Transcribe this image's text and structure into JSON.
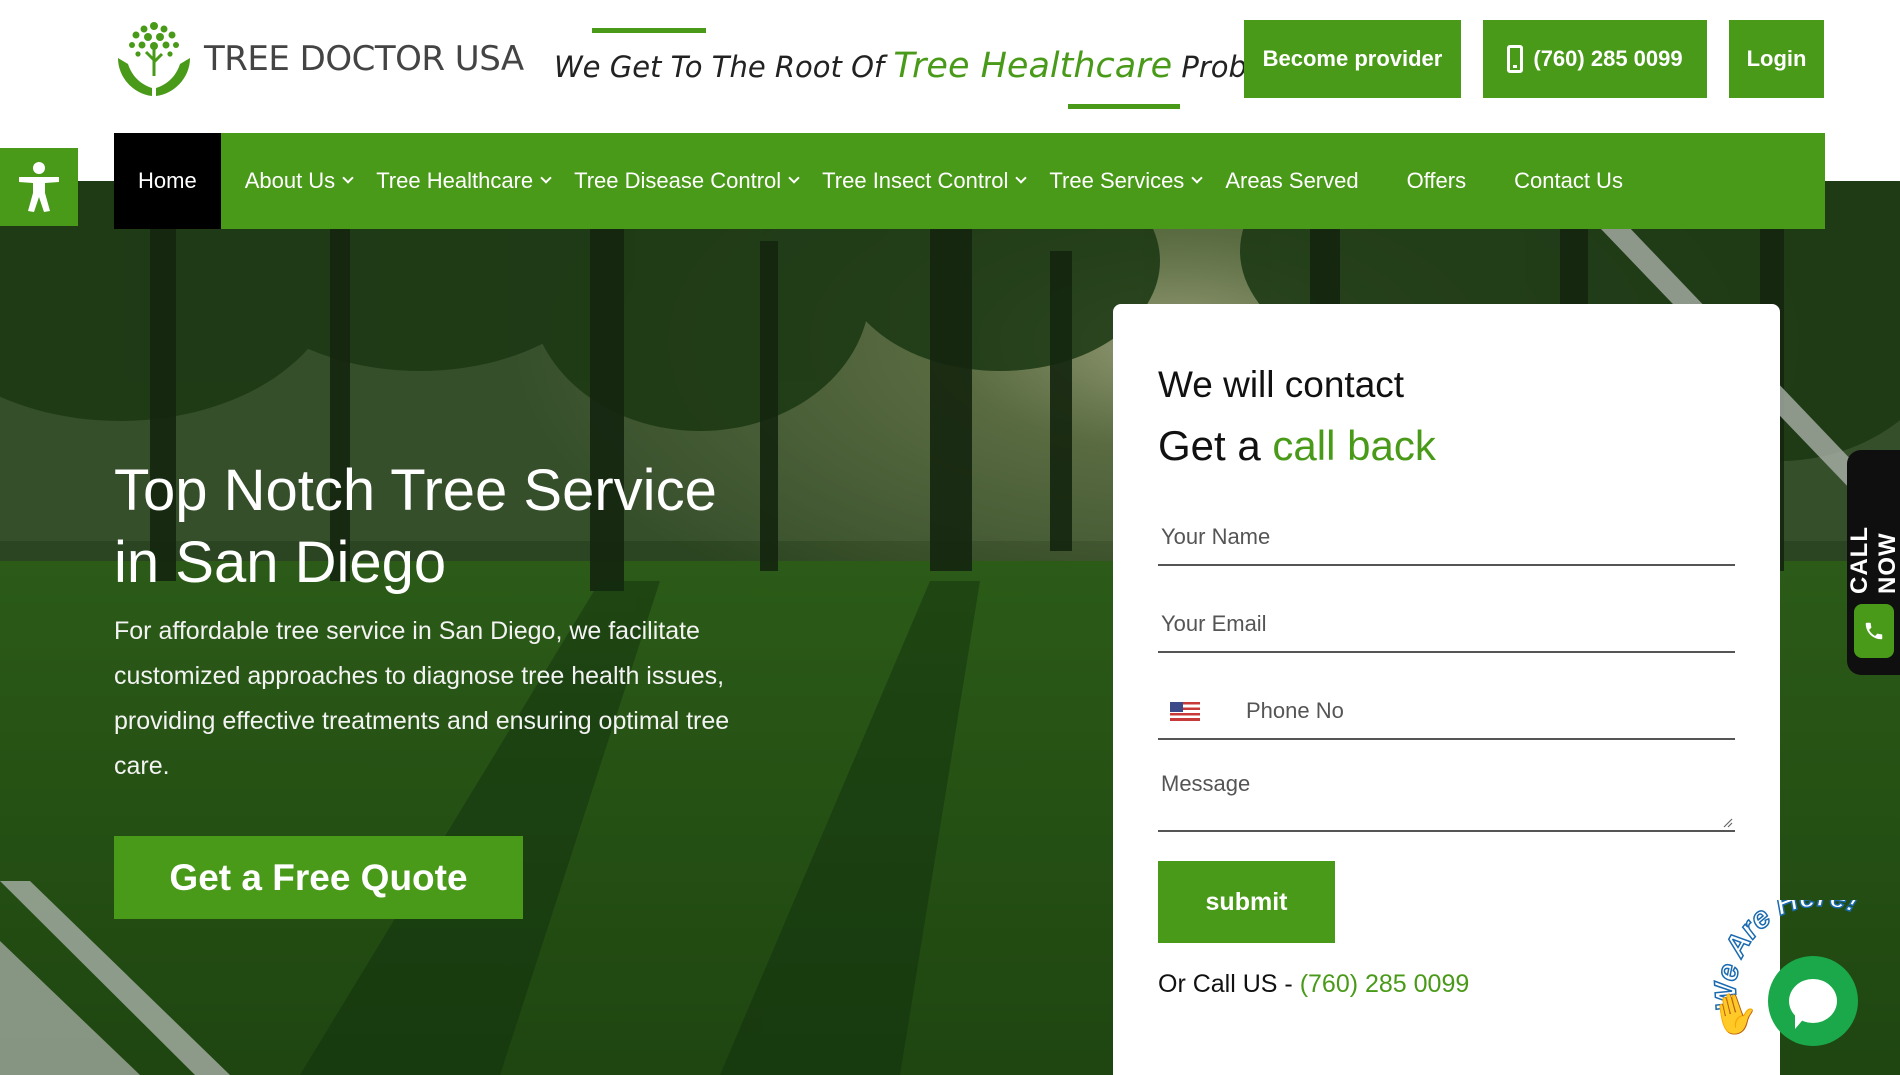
{
  "header": {
    "logo_text": "TREE DOCTOR USA",
    "tagline_pre": "We Get To The Root Of ",
    "tagline_highlight": "Tree Healthcare",
    "tagline_post": " Problems",
    "become_provider_label": "Become provider",
    "phone_label": "(760) 285 0099",
    "login_label": "Login"
  },
  "nav": {
    "items": [
      {
        "label": "Home",
        "active": true,
        "dropdown": false
      },
      {
        "label": "About Us",
        "active": false,
        "dropdown": true
      },
      {
        "label": "Tree Healthcare",
        "active": false,
        "dropdown": true
      },
      {
        "label": "Tree Disease Control",
        "active": false,
        "dropdown": true
      },
      {
        "label": "Tree Insect Control",
        "active": false,
        "dropdown": true
      },
      {
        "label": "Tree Services",
        "active": false,
        "dropdown": true
      },
      {
        "label": "Areas Served",
        "active": false,
        "dropdown": false
      },
      {
        "label": "Offers",
        "active": false,
        "dropdown": false
      },
      {
        "label": "Contact Us",
        "active": false,
        "dropdown": false
      }
    ]
  },
  "hero": {
    "title_line1": "Top Notch Tree Service",
    "title_line2": "in San Diego",
    "text": "For affordable tree service in San Diego, we facilitate customized approaches to diagnose tree health issues, providing effective treatments and ensuring optimal tree care.",
    "cta_label": "Get a Free Quote"
  },
  "form": {
    "heading": "We will contact",
    "subheading_pre": "Get a ",
    "subheading_highlight": "call back",
    "name_placeholder": "Your Name",
    "email_placeholder": "Your Email",
    "phone_placeholder": "Phone No",
    "message_placeholder": "Message",
    "submit_label": "submit",
    "or_call_label": "Or Call US - ",
    "or_call_number": "(760) 285 0099"
  },
  "side_tab": {
    "call_now_label": "CALL NOW"
  },
  "chat": {
    "badge_text": "We Are Here!"
  },
  "colors": {
    "brand_green": "#4a9a1a",
    "nav_active_bg": "#000000",
    "chat_green": "#1aa84a"
  },
  "icons": {
    "accessibility": "accessibility-icon",
    "phone": "phone-icon",
    "chat": "chat-icon",
    "wave": "waving-hand-icon"
  }
}
